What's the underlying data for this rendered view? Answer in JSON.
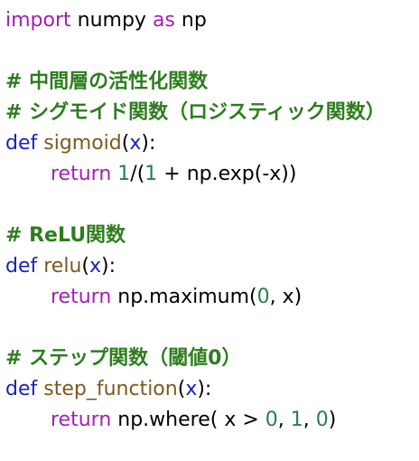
{
  "colors": {
    "keyword_import": "#a31fb8",
    "keyword_def": "#1a23b8",
    "keyword_return": "#a31fb8",
    "function_name": "#7a5a1e",
    "parameter": "#1a23b8",
    "number": "#2a7d4f",
    "comment": "#2e7d1e",
    "text": "#000000",
    "background": "#ffffff"
  },
  "code": {
    "import_line": {
      "kw_import": "import",
      "module": " numpy ",
      "kw_as": "as",
      "alias": " np"
    },
    "comment_activation": "# 中間層の活性化関数",
    "comment_sigmoid": "# シグモイド関数（ロジスティック関数）",
    "sigmoid_def": {
      "kw_def": "def",
      "name": "sigmoid",
      "open": "(",
      "param": "x",
      "close": "):"
    },
    "sigmoid_return": {
      "kw_return": "return",
      "num_1": "1",
      "mid": "/(",
      "num_2": "1",
      "rest": " + np.exp(-x))"
    },
    "comment_relu": "# ReLU関数",
    "relu_def": {
      "kw_def": "def",
      "name": "relu",
      "open": "(",
      "param": "x",
      "close": "):"
    },
    "relu_return": {
      "kw_return": "return",
      "call": " np.maximum(",
      "num_0": "0",
      "rest": ", x)"
    },
    "comment_step": "# ステップ関数（閾値0）",
    "step_def": {
      "kw_def": "def",
      "name": "step_function",
      "open": "(",
      "param": "x",
      "close": "):"
    },
    "step_return": {
      "kw_return": "return",
      "call": " np.where( x > ",
      "num_0": "0",
      "sep1": ", ",
      "num_1": "1",
      "sep2": ", ",
      "num_0b": "0",
      "close": ")"
    }
  }
}
